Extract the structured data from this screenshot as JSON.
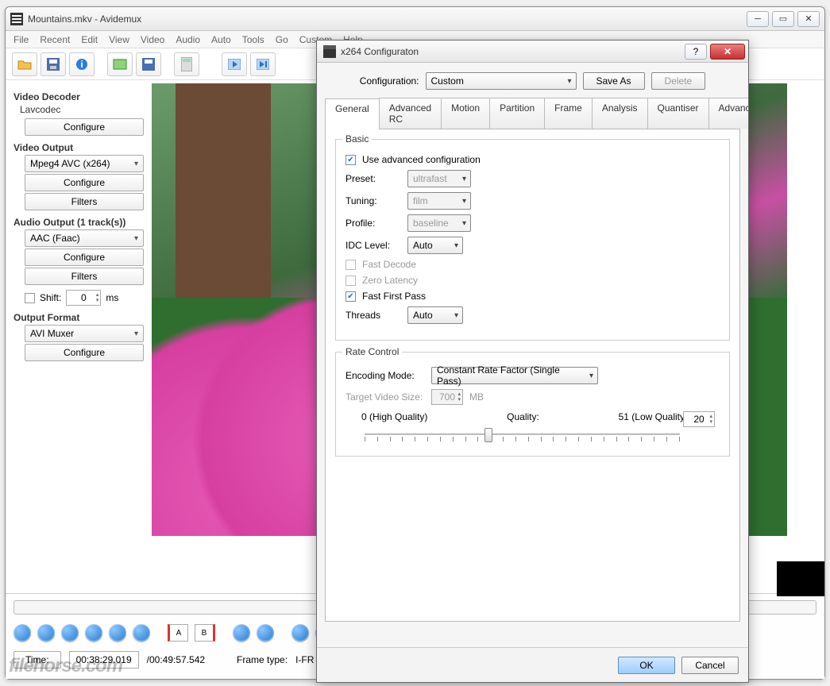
{
  "window": {
    "title": "Mountains.mkv - Avidemux",
    "menus": [
      "File",
      "Recent",
      "Edit",
      "View",
      "Video",
      "Audio",
      "Auto",
      "Tools",
      "Go",
      "Custom",
      "Help"
    ]
  },
  "sidebar": {
    "video_decoder_label": "Video Decoder",
    "video_decoder_sub": "Lavcodec",
    "configure_label": "Configure",
    "video_output_label": "Video Output",
    "video_output_value": "Mpeg4 AVC (x264)",
    "filters_label": "Filters",
    "audio_output_label": "Audio Output (1 track(s))",
    "audio_output_value": "AAC (Faac)",
    "shift_label": "Shift:",
    "shift_value": "0",
    "shift_unit": "ms",
    "output_format_label": "Output Format",
    "output_format_value": "AVI Muxer"
  },
  "transport": {
    "time_label": "Time:",
    "time_current": "00:38:29.019",
    "time_total": "/00:49:57.542",
    "frame_type_label": "Frame type:",
    "frame_type_value": "I-FR"
  },
  "watermark": "filehorse.com",
  "dialog": {
    "title": "x264 Configuraton",
    "config_label": "Configuration:",
    "config_value": "Custom",
    "save_as": "Save As",
    "delete": "Delete",
    "tabs": [
      "General",
      "Advanced RC",
      "Motion",
      "Partition",
      "Frame",
      "Analysis",
      "Quantiser",
      "Advanced"
    ],
    "basic": {
      "legend": "Basic",
      "use_advanced": "Use advanced configuration",
      "preset_label": "Preset:",
      "preset_value": "ultrafast",
      "tuning_label": "Tuning:",
      "tuning_value": "film",
      "profile_label": "Profile:",
      "profile_value": "baseline",
      "idc_label": "IDC Level:",
      "idc_value": "Auto",
      "fast_decode": "Fast Decode",
      "zero_latency": "Zero Latency",
      "fast_first_pass": "Fast First Pass",
      "threads_label": "Threads",
      "threads_value": "Auto"
    },
    "rate": {
      "legend": "Rate Control",
      "encoding_mode_label": "Encoding Mode:",
      "encoding_mode_value": "Constant Rate Factor (Single Pass)",
      "target_label": "Target Video Size:",
      "target_value": "700",
      "target_unit": "MB",
      "q_low": "0 (High Quality)",
      "q_label": "Quality:",
      "q_high": "51 (Low Quality)",
      "q_value": "20"
    },
    "ok": "OK",
    "cancel": "Cancel"
  }
}
